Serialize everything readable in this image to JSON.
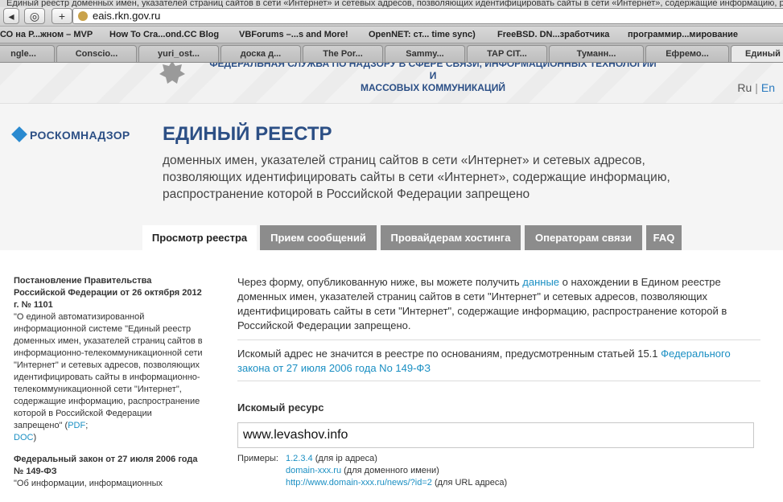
{
  "browser": {
    "title_fragment": "Единый реестр доменных имен, указателей страниц сайтов в сети «Интернет» и сетевых адресов, позволяющих идентифицировать сайты в сети «Интернет», содержащие информацию, распространение которой в Российской Федерации запрещено",
    "url": "eais.rkn.gov.ru",
    "bookmarks": [
      "СО на Р...жном – MVP",
      "How To Cra...ond.CC Blog",
      "VBForums –...s and More!",
      "OpenNET: ст... time sync)",
      "FreeBSD. DN...зработчика",
      "программир...мирование"
    ],
    "tabs": [
      "ngle...",
      "Conscio...",
      "yuri_ost...",
      "доска д...",
      "The Por...",
      "Sammy...",
      "TAP CIT...",
      "Туманн...",
      "Ефремо...",
      "Единый"
    ]
  },
  "header": {
    "agency_line1": "ФЕДЕРАЛЬНАЯ СЛУЖБА ПО НАДЗОРУ В СФЕРЕ СВЯЗИ, ИНФОРМАЦИОННЫХ ТЕХНОЛОГИЙ И",
    "agency_line2": "МАССОВЫХ КОММУНИКАЦИЙ",
    "lang_ru": "Ru",
    "lang_sep": "|",
    "lang_en": "En"
  },
  "banner": {
    "logo": "РОСКОМНАДЗОР",
    "title": "ЕДИНЫЙ РЕЕСТР",
    "subtitle": "доменных имен, указателей страниц сайтов в сети «Интернет» и сетевых адресов, позволяющих идентифицировать сайты в сети «Интернет», содержащие информацию, распространение которой в Российской Федерации запрещено"
  },
  "nav": {
    "tabs": [
      "Просмотр реестра",
      "Прием сообщений",
      "Провайдерам хостинга",
      "Операторам связи",
      "FAQ"
    ]
  },
  "sidebar": {
    "doc1_title": "Постановление Правительства Российской Федерации от 26 октября 2012 г. № 1101",
    "doc1_text": "\"О единой автоматизированной информационной системе \"Единый реестр доменных имен, указателей страниц сайтов в информационно-телекоммуникационной сети \"Интернет\" и сетевых адресов, позволяющих идентифицировать сайты в информационно-телекоммуникационной сети \"Интернет\", содержащие информацию, распространение которой в Российской Федерации запрещено\" (",
    "doc1_pdf": "PDF",
    "doc1_sep": ";",
    "doc1_doc": "DOC",
    "doc1_close": ")",
    "doc2_title": "Федеральный закон от 27 июля 2006 года № 149-ФЗ",
    "doc2_text": "\"Об информации, информационных"
  },
  "main": {
    "intro_before": "Через форму, опубликованную ниже, вы можете получить ",
    "intro_link": "данные",
    "intro_after": " о нахождении в Едином реестре доменных имен, указателей страниц сайтов в сети \"Интернет\" и сетевых адресов, позволяющих идентифицировать сайты в сети \"Интернет\", содержащие информацию, распространение которой в Российской Федерации запрещено.",
    "notice_before": "Искомый адрес не значится в реестре по основаниям, предусмотренным статьей 15.1 ",
    "notice_link": "Федерального закона от 27 июля 2006 года No 149-ФЗ",
    "resource_label": "Искомый ресурс",
    "resource_value": "www.levashov.info",
    "examples_label": "Примеры:",
    "examples": [
      {
        "link": "1.2.3.4",
        "note": " (для ip адреса)"
      },
      {
        "link": "domain-xxx.ru",
        "note": " (для доменного имени)"
      },
      {
        "link": "http://www.domain-xxx.ru/news/?id=2",
        "note": " (для URL адреса)"
      }
    ]
  },
  "colors": {
    "brand_blue": "#2c4f85",
    "link_blue": "#1a8fc3",
    "tab_grey": "#8c8c8c"
  }
}
